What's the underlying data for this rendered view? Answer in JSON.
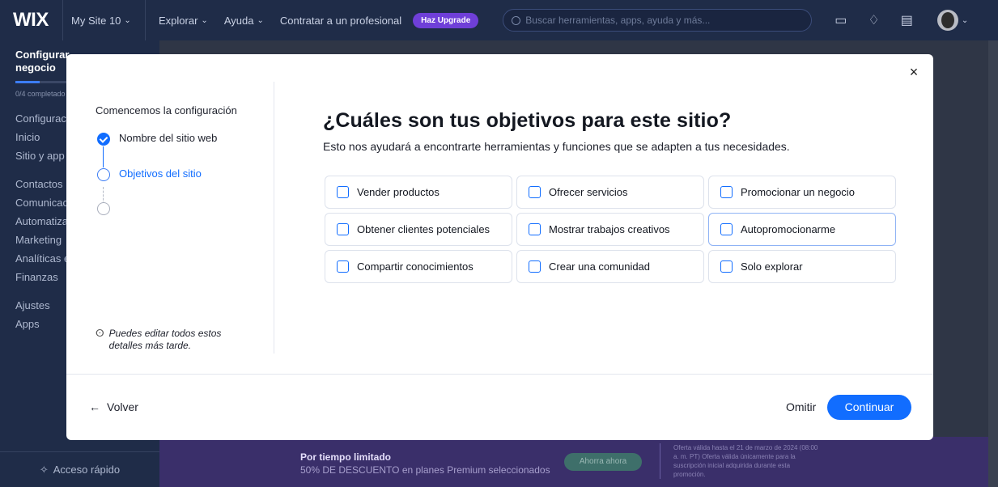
{
  "topbar": {
    "logo": "WIX",
    "site_name": "My Site 10",
    "nav": [
      "Explorar",
      "Ayuda",
      "Contratar a un profesional"
    ],
    "upgrade_label": "Haz Upgrade",
    "search_placeholder": "Buscar herramientas, apps, ayuda y más...",
    "icons": [
      "chat-icon",
      "bell-icon",
      "news-icon",
      "avatar"
    ]
  },
  "sidebar": {
    "title_line1": "Configurar",
    "title_line2": "negocio",
    "progress_text": "0/4 completado",
    "progress_fraction": 0.0,
    "items": [
      "Configuración",
      "Inicio",
      "Sitio y app",
      "Contactos",
      "Comunicación",
      "Automatizaciones",
      "Marketing",
      "Analíticas e",
      "Finanzas",
      "Ajustes",
      "Apps"
    ],
    "quick_access": "Acceso rápido"
  },
  "promo": {
    "title": "Por tiempo limitado",
    "subtitle": "50% DE DESCUENTO en planes Premium seleccionados",
    "button": "Ahorra ahora",
    "fine_print": "Oferta válida hasta el 21 de marzo de 2024 (08:00 a. m. PT) Oferta válida únicamente para la suscripción inicial adquirida durante esta promoción."
  },
  "modal": {
    "close_label": "×",
    "steps_title": "Comencemos la configuración",
    "steps": [
      {
        "label": "Nombre del sitio web",
        "state": "done"
      },
      {
        "label": "Objetivos del sitio",
        "state": "current"
      },
      {
        "label": "",
        "state": "todo"
      }
    ],
    "tip": "Puedes editar todos estos detalles más tarde.",
    "title": "¿Cuáles son tus objetivos para este sitio?",
    "subtitle": "Esto nos ayudará a encontrarte herramientas y funciones que se adapten a tus necesidades.",
    "options": [
      "Vender productos",
      "Ofrecer servicios",
      "Promocionar un negocio",
      "Obtener clientes potenciales",
      "Mostrar trabajos creativos",
      "Autopromocionarme",
      "Compartir conocimientos",
      "Crear una comunidad",
      "Solo explorar"
    ],
    "back_label": "Volver",
    "skip_label": "Omitir",
    "continue_label": "Continuar"
  },
  "colors": {
    "accent": "#116dff",
    "topbar_bg": "#1f2c48",
    "upgrade": "#6f3fd8"
  }
}
